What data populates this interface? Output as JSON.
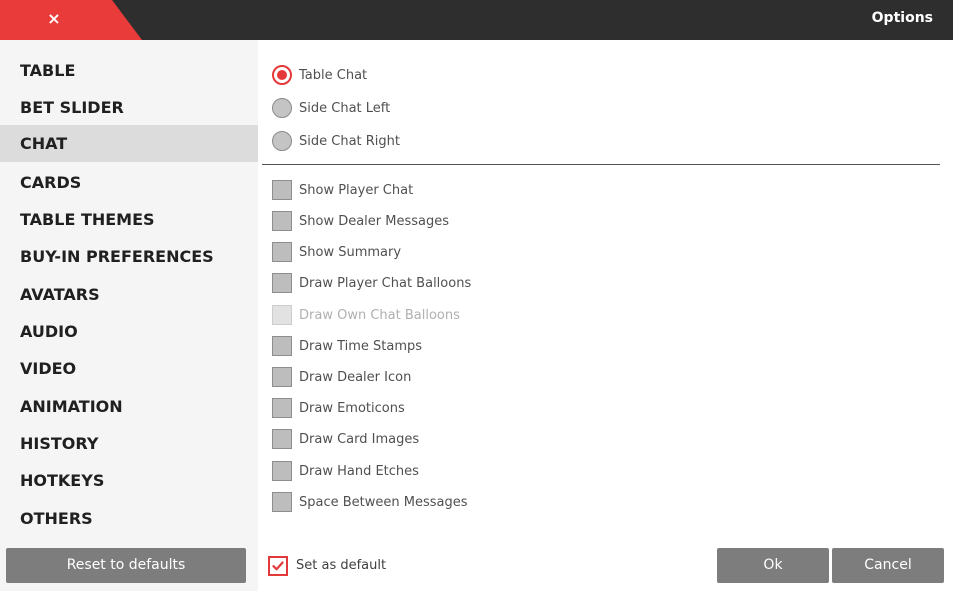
{
  "titlebar": {
    "close_glyph": "×",
    "title": "Options",
    "accent_color": "#ea3b3b",
    "background_color": "#2e2e2e"
  },
  "sidebar": {
    "items": [
      {
        "label": "TABLE"
      },
      {
        "label": "BET SLIDER"
      },
      {
        "label": "CHAT",
        "active": true
      },
      {
        "label": "CARDS"
      },
      {
        "label": "TABLE THEMES"
      },
      {
        "label": "BUY-IN PREFERENCES"
      },
      {
        "label": "AVATARS"
      },
      {
        "label": "AUDIO"
      },
      {
        "label": "VIDEO"
      },
      {
        "label": "ANIMATION"
      },
      {
        "label": "HISTORY"
      },
      {
        "label": "HOTKEYS"
      },
      {
        "label": "OTHERS"
      }
    ],
    "reset_label": "Reset to defaults"
  },
  "chat": {
    "position_options": [
      {
        "label": "Table Chat",
        "selected": true
      },
      {
        "label": "Side Chat Left",
        "selected": false
      },
      {
        "label": "Side Chat Right",
        "selected": false
      }
    ],
    "checkboxes": [
      {
        "label": "Show Player Chat",
        "checked": false,
        "enabled": true
      },
      {
        "label": "Show Dealer Messages",
        "checked": false,
        "enabled": true
      },
      {
        "label": "Show Summary",
        "checked": false,
        "enabled": true
      },
      {
        "label": "Draw Player Chat Balloons",
        "checked": false,
        "enabled": true
      },
      {
        "label": "Draw Own Chat Balloons",
        "checked": false,
        "enabled": false
      },
      {
        "label": "Draw Time Stamps",
        "checked": false,
        "enabled": true
      },
      {
        "label": "Draw Dealer Icon",
        "checked": false,
        "enabled": true
      },
      {
        "label": "Draw Emoticons",
        "checked": false,
        "enabled": true
      },
      {
        "label": "Draw Card Images",
        "checked": false,
        "enabled": true
      },
      {
        "label": "Draw Hand Etches",
        "checked": false,
        "enabled": true
      },
      {
        "label": "Space Between Messages",
        "checked": false,
        "enabled": true
      }
    ]
  },
  "footer": {
    "set_default_label": "Set as default",
    "set_default_checked": true,
    "ok_label": "Ok",
    "cancel_label": "Cancel"
  }
}
